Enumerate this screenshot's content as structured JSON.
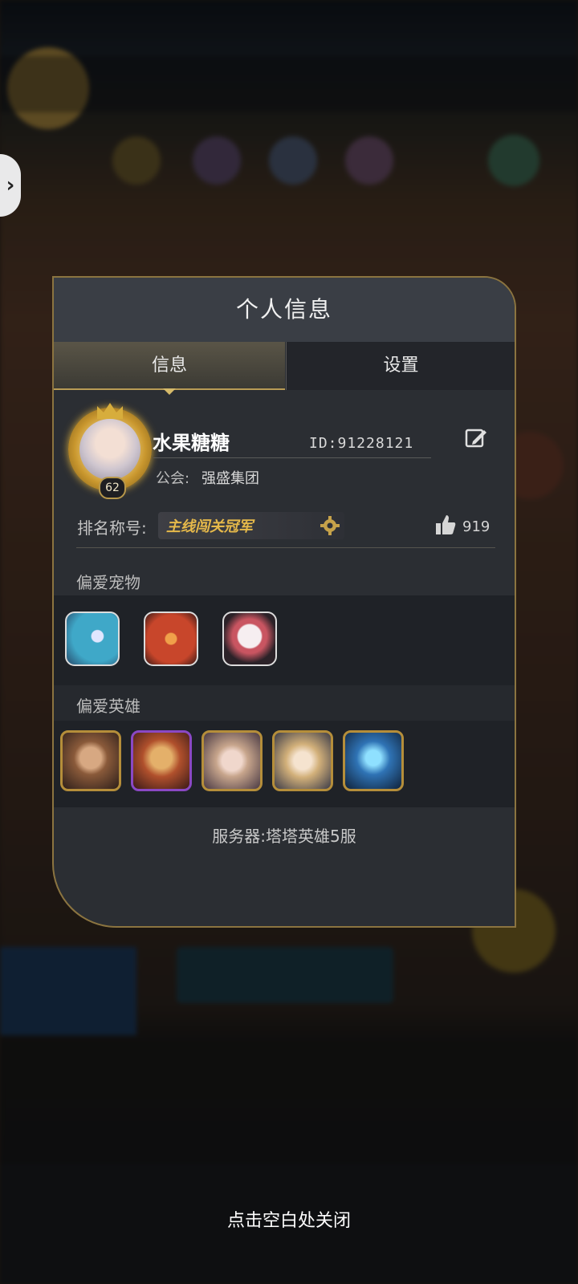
{
  "dialog": {
    "title": "个人信息",
    "tabs": [
      {
        "label": "信息",
        "selected": true
      },
      {
        "label": "设置",
        "selected": false
      }
    ]
  },
  "profile": {
    "username": "水果糖糖",
    "id": "ID:91228121",
    "level": "62",
    "guild_label": "公会:",
    "guild_name": "强盛集团",
    "rank_label": "排名称号:",
    "rank_title": "主线闯关冠军",
    "likes": "919"
  },
  "pets": {
    "label": "偏爱宠物",
    "items": [
      {
        "icon": "blue-dragon-pet-icon",
        "color": "#3fa8c8"
      },
      {
        "icon": "red-dragon-pet-icon",
        "color": "#c8462b"
      },
      {
        "icon": "vampire-pet-icon",
        "color": "#e9e1e6"
      }
    ]
  },
  "heroes": {
    "label": "偏爱英雄",
    "items": [
      {
        "icon": "hero-warrior-icon",
        "frame": "#b58e3a",
        "color": "#8a5a3a"
      },
      {
        "icon": "hero-knight-icon",
        "frame": "#8a48c4",
        "color": "#b0502c"
      },
      {
        "icon": "hero-lady-icon",
        "frame": "#b58e3a",
        "color": "#c7a58c"
      },
      {
        "icon": "hero-scholar-icon",
        "frame": "#b58e3a",
        "color": "#d2b07a"
      },
      {
        "icon": "hero-ice-beast-icon",
        "frame": "#b58e3a",
        "color": "#2f73b5"
      }
    ]
  },
  "server": "服务器:塔塔英雄5服",
  "close_hint": "点击空白处关闭"
}
